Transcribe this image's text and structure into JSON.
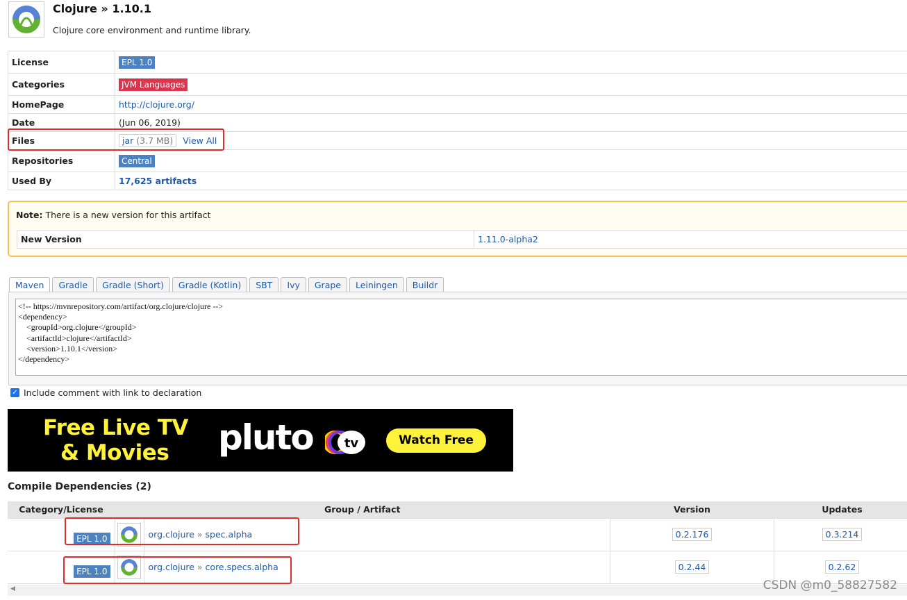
{
  "header": {
    "title": "Clojure » 1.10.1",
    "subtitle": "Clojure core environment and runtime library."
  },
  "info": {
    "license_label": "License",
    "license_value": "EPL 1.0",
    "categories_label": "Categories",
    "categories_value": "JVM Languages",
    "homepage_label": "HomePage",
    "homepage_value": "http://clojure.org/",
    "date_label": "Date",
    "date_value": "(Jun 06, 2019)",
    "files_label": "Files",
    "files_jar": "jar",
    "files_size": "(3.7 MB)",
    "files_viewall": "View All",
    "repositories_label": "Repositories",
    "repositories_value": "Central",
    "usedby_label": "Used By",
    "usedby_value": "17,625 artifacts"
  },
  "note": {
    "label": "Note:",
    "text": "There is a new version for this artifact",
    "new_version_label": "New Version",
    "new_version_value": "1.11.0-alpha2"
  },
  "tabs": [
    "Maven",
    "Gradle",
    "Gradle (Short)",
    "Gradle (Kotlin)",
    "SBT",
    "Ivy",
    "Grape",
    "Leiningen",
    "Buildr"
  ],
  "code": "<!-- https://mvnrepository.com/artifact/org.clojure/clojure -->\n<dependency>\n    <groupId>org.clojure</groupId>\n    <artifactId>clojure</artifactId>\n    <version>1.10.1</version>\n</dependency>",
  "include_comment": {
    "checked": true,
    "label": "Include comment with link to declaration"
  },
  "ad": {
    "line1": "Free Live TV",
    "line2": "& Movies",
    "brand": "pluto",
    "brand_tv": "tv",
    "button": "Watch Free"
  },
  "dependencies": {
    "title": "Compile Dependencies (2)",
    "headers": {
      "category": "Category/License",
      "artifact": "Group / Artifact",
      "version": "Version",
      "updates": "Updates"
    },
    "rows": [
      {
        "license": "EPL 1.0",
        "group": "org.clojure",
        "sep": "»",
        "artifact": "spec.alpha",
        "version": "0.2.176",
        "update": "0.3.214"
      },
      {
        "license": "EPL 1.0",
        "group": "org.clojure",
        "sep": "»",
        "artifact": "core.specs.alpha",
        "version": "0.2.44",
        "update": "0.2.62"
      }
    ]
  },
  "watermark": "CSDN @m0_58827582",
  "colors": {
    "link": "#1f5aa8",
    "badge_blue": "#4d82c0",
    "badge_red": "#d9364d",
    "annotation_red": "#e22b2b",
    "note_border": "#f5c14e",
    "ad_yellow": "#fff23b"
  }
}
